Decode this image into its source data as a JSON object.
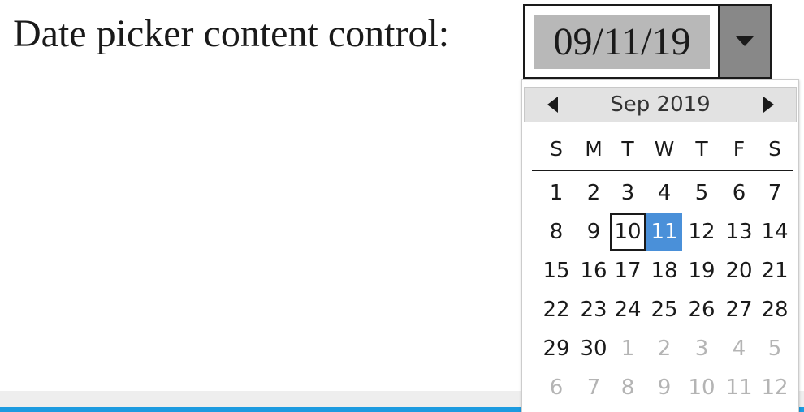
{
  "document": {
    "label": "Date picker content control:",
    "date_value": "09/11/19"
  },
  "icons": {
    "dropdown": "chevron-down-icon",
    "prev": "arrow-left-icon",
    "next": "arrow-right-icon"
  },
  "colors": {
    "date_highlight": "#b8b8b8",
    "dropdown_button": "#888888",
    "selected_day": "#4a90d9",
    "accent_bar": "#1c9be0"
  },
  "calendar": {
    "month_label": "Sep 2019",
    "weekdays": [
      "S",
      "M",
      "T",
      "W",
      "T",
      "F",
      "S"
    ],
    "today": "10",
    "selected": "11",
    "weeks": [
      [
        {
          "d": "1",
          "cur": true
        },
        {
          "d": "2",
          "cur": true
        },
        {
          "d": "3",
          "cur": true
        },
        {
          "d": "4",
          "cur": true
        },
        {
          "d": "5",
          "cur": true
        },
        {
          "d": "6",
          "cur": true
        },
        {
          "d": "7",
          "cur": true
        }
      ],
      [
        {
          "d": "8",
          "cur": true
        },
        {
          "d": "9",
          "cur": true
        },
        {
          "d": "10",
          "cur": true
        },
        {
          "d": "11",
          "cur": true
        },
        {
          "d": "12",
          "cur": true
        },
        {
          "d": "13",
          "cur": true
        },
        {
          "d": "14",
          "cur": true
        }
      ],
      [
        {
          "d": "15",
          "cur": true
        },
        {
          "d": "16",
          "cur": true
        },
        {
          "d": "17",
          "cur": true
        },
        {
          "d": "18",
          "cur": true
        },
        {
          "d": "19",
          "cur": true
        },
        {
          "d": "20",
          "cur": true
        },
        {
          "d": "21",
          "cur": true
        }
      ],
      [
        {
          "d": "22",
          "cur": true
        },
        {
          "d": "23",
          "cur": true
        },
        {
          "d": "24",
          "cur": true
        },
        {
          "d": "25",
          "cur": true
        },
        {
          "d": "26",
          "cur": true
        },
        {
          "d": "27",
          "cur": true
        },
        {
          "d": "28",
          "cur": true
        }
      ],
      [
        {
          "d": "29",
          "cur": true
        },
        {
          "d": "30",
          "cur": true
        },
        {
          "d": "1",
          "cur": false
        },
        {
          "d": "2",
          "cur": false
        },
        {
          "d": "3",
          "cur": false
        },
        {
          "d": "4",
          "cur": false
        },
        {
          "d": "5",
          "cur": false
        }
      ],
      [
        {
          "d": "6",
          "cur": false
        },
        {
          "d": "7",
          "cur": false
        },
        {
          "d": "8",
          "cur": false
        },
        {
          "d": "9",
          "cur": false
        },
        {
          "d": "10",
          "cur": false
        },
        {
          "d": "11",
          "cur": false
        },
        {
          "d": "12",
          "cur": false
        }
      ]
    ]
  }
}
